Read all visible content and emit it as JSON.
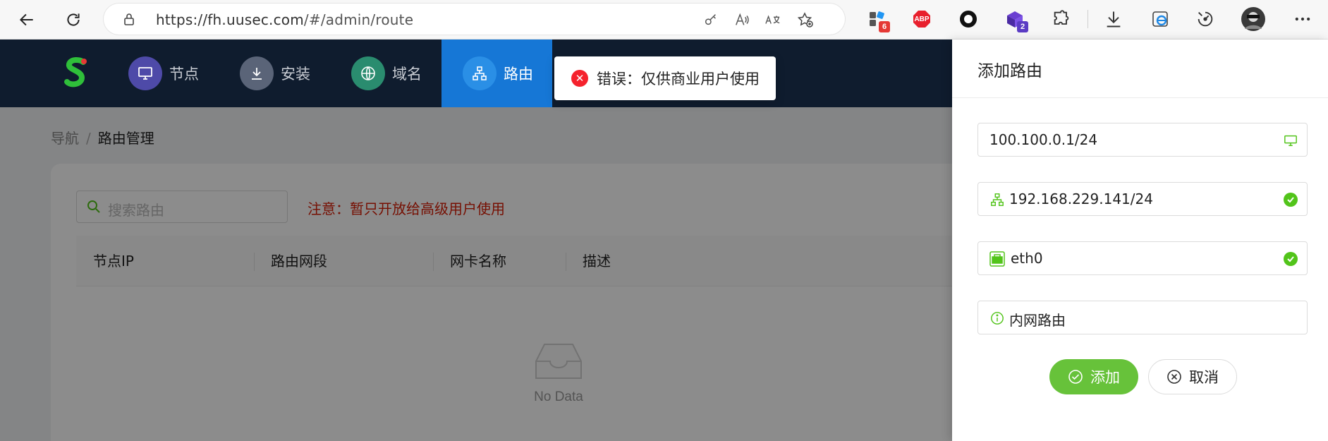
{
  "browser": {
    "url_host": "https://fh.uusec.com",
    "url_path": "/#/admin/route",
    "ext_badges": {
      "collections": "6",
      "extension2": "2"
    },
    "abp_label": "ABP"
  },
  "nav": {
    "items": [
      {
        "label": "节点"
      },
      {
        "label": "安装"
      },
      {
        "label": "域名"
      },
      {
        "label": "路由"
      }
    ],
    "active": "路由"
  },
  "breadcrumb": {
    "root": "导航",
    "current": "路由管理"
  },
  "search": {
    "placeholder": "搜索路由"
  },
  "notice": "注意：暂只开放给高级用户使用",
  "table": {
    "columns": [
      "节点IP",
      "路由网段",
      "网卡名称",
      "描述"
    ],
    "empty_text": "No Data"
  },
  "toast": {
    "message": "错误：仅供商业用户使用",
    "type": "error"
  },
  "drawer": {
    "title": "添加路由",
    "fields": {
      "node_ip": "100.100.0.1/24",
      "subnet": "192.168.229.141/24",
      "interface": "eth0",
      "description": "内网路由"
    },
    "add_label": "添加",
    "cancel_label": "取消"
  },
  "colors": {
    "nav_bg": "#0f1c2e",
    "active": "#1677d6",
    "success": "#52c41a",
    "error": "#f5222d",
    "add_button": "#67c23a"
  }
}
